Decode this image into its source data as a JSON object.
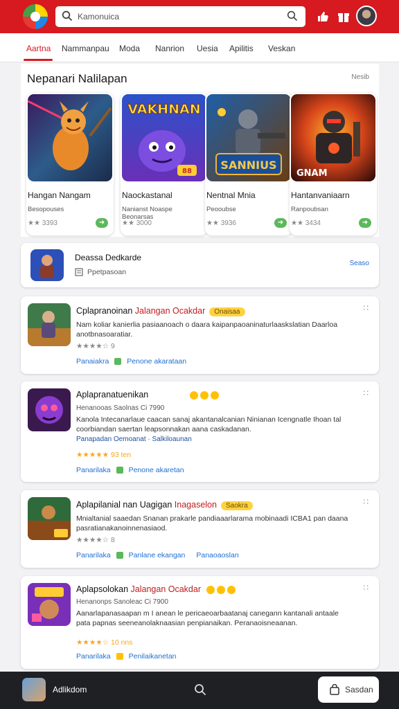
{
  "header": {
    "search_text": "Kamonuica",
    "brand_color": "#d71920"
  },
  "tabs": [
    "Aartna",
    "Nammanpau",
    "Moda",
    "Nanrion",
    "Uesia",
    "Apilitis",
    "Veskan"
  ],
  "featured": {
    "title": "Nepanari Nalilapan",
    "more_label": "Nesib",
    "games": [
      {
        "name": "Hangan Nangam",
        "sub": "Besopouses",
        "rating": "★★ 3393",
        "art": "game-art-1"
      },
      {
        "name": "Naockastanal",
        "sub": "Nanianst Noaspe\nBeonarsas",
        "rating": "★★ 3000",
        "art": "game-art-2"
      },
      {
        "name": "Nentnal Mnia",
        "sub": "Peooubse",
        "rating": "★★ 3936",
        "art": "game-art-3"
      },
      {
        "name": "Hantanvaniaarn",
        "sub": "Ranpoubsan",
        "rating": "★★ 3434",
        "art": "game-art-4"
      }
    ],
    "art_text": {
      "game2": "VAKHNAN",
      "game3": "SANNIUS",
      "game4": "GNAM"
    }
  },
  "promo": {
    "title": "Deassa Dedkarde",
    "sub": "Ppetpasoan",
    "action": "Seaso"
  },
  "apps": [
    {
      "title": "Cplapranoinan",
      "highlight": "Jalangan Ocakdar",
      "badge": "Onaisaa",
      "desc": "Nam koliar kanierlia pasiaanoach o daara kaipanpaoaninaturlaaskslatian Daarloa anotbnasoaratiar.",
      "sub": "",
      "rating": "★★★★☆ 9",
      "links": [
        "Panaiakra",
        "Penone akarataan"
      ]
    },
    {
      "title": "Aplapranatuenikan",
      "highlight": "",
      "badge": "",
      "desc": "Kanola Intecanarlaue caacan sanaj akantanalcanian Ninianan Icengnatle Ihoan tal coorbiandan saertan leapsonnakan aana caskadanan.",
      "sub": "Panapadan Oemoanat  ·  Salkiloaunan",
      "rating": "★★★★★ 93 ten",
      "meta": "Henanooas Saolnas Ci 7990",
      "links": [
        "Panarilaka",
        "Penone akaretan"
      ]
    },
    {
      "title": "Aplapilanial nan Uagigan",
      "highlight": "Inagaselon",
      "badge": "Saokra",
      "desc": "Mnialtanial saaedan Snanan prakarle pandiaaarlarama mobinaadi ICBA1 pan daana pasratianakanoinnenasiaod.",
      "sub": "",
      "rating": "★★★★☆ 8",
      "links": [
        "Panarilaka",
        "Panlane ekangan",
        "Panaoaoslan"
      ]
    },
    {
      "title": "Aplapsolokan",
      "highlight": "Jalangan Ocakdar",
      "badge": "",
      "desc": "Aanarlapanasaapan m I anean le pericaeoarbaatanaj canegann kantanali antaale pata papnas seeneanolaknaasian penpianaikan. Peranaoisneaanan.",
      "sub": "",
      "rating": "★★★★☆ 10 nns",
      "meta": "Henanonps Sanoleac Ci 7900",
      "links": [
        "Panarilaka",
        "Penilaikanetan"
      ]
    }
  ],
  "bottombar": {
    "name": "Adlikdom",
    "button_label": "Sasdan"
  }
}
